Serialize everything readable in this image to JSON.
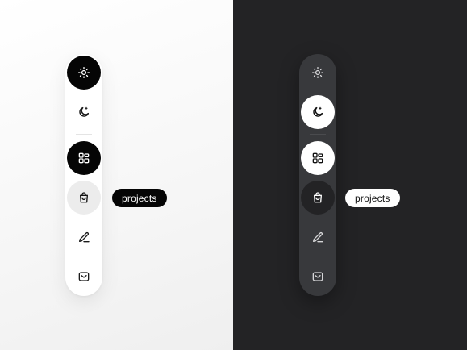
{
  "tooltip": {
    "label": "projects"
  },
  "sidebar": {
    "items": [
      {
        "id": "light-mode",
        "icon": "sun-icon"
      },
      {
        "id": "dark-mode",
        "icon": "moon-icon"
      },
      {
        "id": "dashboard",
        "icon": "dashboard-grid-icon"
      },
      {
        "id": "projects",
        "icon": "shopping-bag-icon"
      },
      {
        "id": "edit",
        "icon": "pencil-icon"
      },
      {
        "id": "inbox",
        "icon": "inbox-icon"
      }
    ]
  },
  "themes": {
    "light": {
      "background": "#ffffff",
      "sidebar": "#ffffff",
      "active": "#050505",
      "hover": "#ececec"
    },
    "dark": {
      "background": "#232325",
      "sidebar": "#38393c",
      "active": "#ffffff",
      "hover": "#232325"
    }
  }
}
